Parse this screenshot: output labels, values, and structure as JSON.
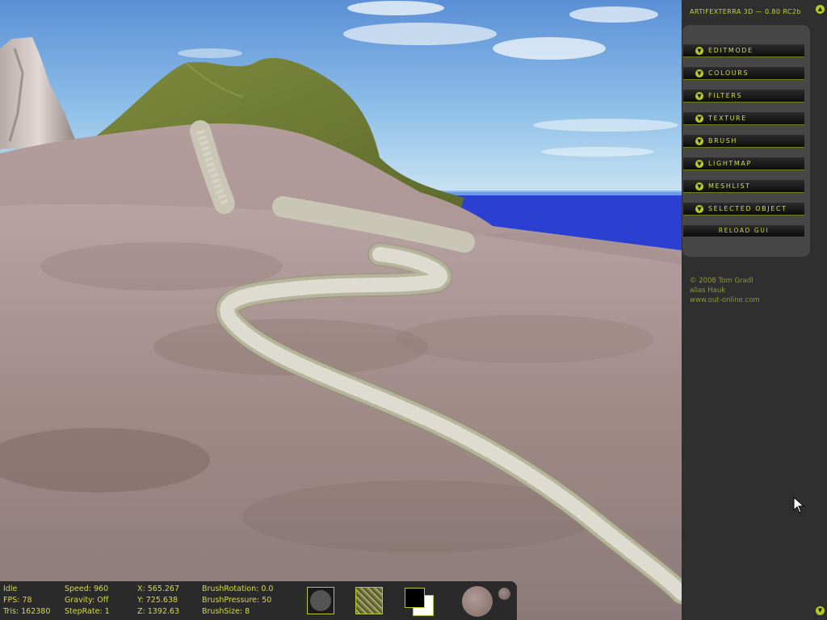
{
  "panel": {
    "app_title": "ARTIFEXTERRA 3D — 0.80 RC2b",
    "scroll_up_icon": "chevron-up-icon",
    "scroll_down_icon": "chevron-down-icon",
    "menu": [
      {
        "label": "EDITMODE"
      },
      {
        "label": "COLOURS"
      },
      {
        "label": "FILTERS"
      },
      {
        "label": "TEXTURE"
      },
      {
        "label": "BRUSH"
      },
      {
        "label": "LIGHTMAP"
      },
      {
        "label": "MESHLIST"
      },
      {
        "label": "SELECTED OBJECT"
      }
    ],
    "reload_label": "RELOAD GUI",
    "credits": {
      "line1": "© 2008 Tom Gradl",
      "line2": "alias Hauk",
      "line3": "www.out-online.com"
    }
  },
  "status": {
    "state": "Idle",
    "fps": "FPS: 78",
    "tris": "Tris: 162380",
    "speed": "Speed: 960",
    "gravity": "Gravity: Off",
    "steprate": "StepRate: 1",
    "x": "X: 565.267",
    "y": "Y: 725.638",
    "z": "Z: 1392.63",
    "brush_rotation": "BrushRotation: 0.0",
    "brush_pressure": "BrushPressure: 50",
    "brush_size": "BrushSize: 8"
  },
  "colors": {
    "accent": "#c8d23a",
    "panel_bg": "#2f2f2f",
    "menu_bg": "#474747",
    "sky_top": "#5b8fd6",
    "sea": "#2b3fd0",
    "terrain": "#a99595"
  }
}
